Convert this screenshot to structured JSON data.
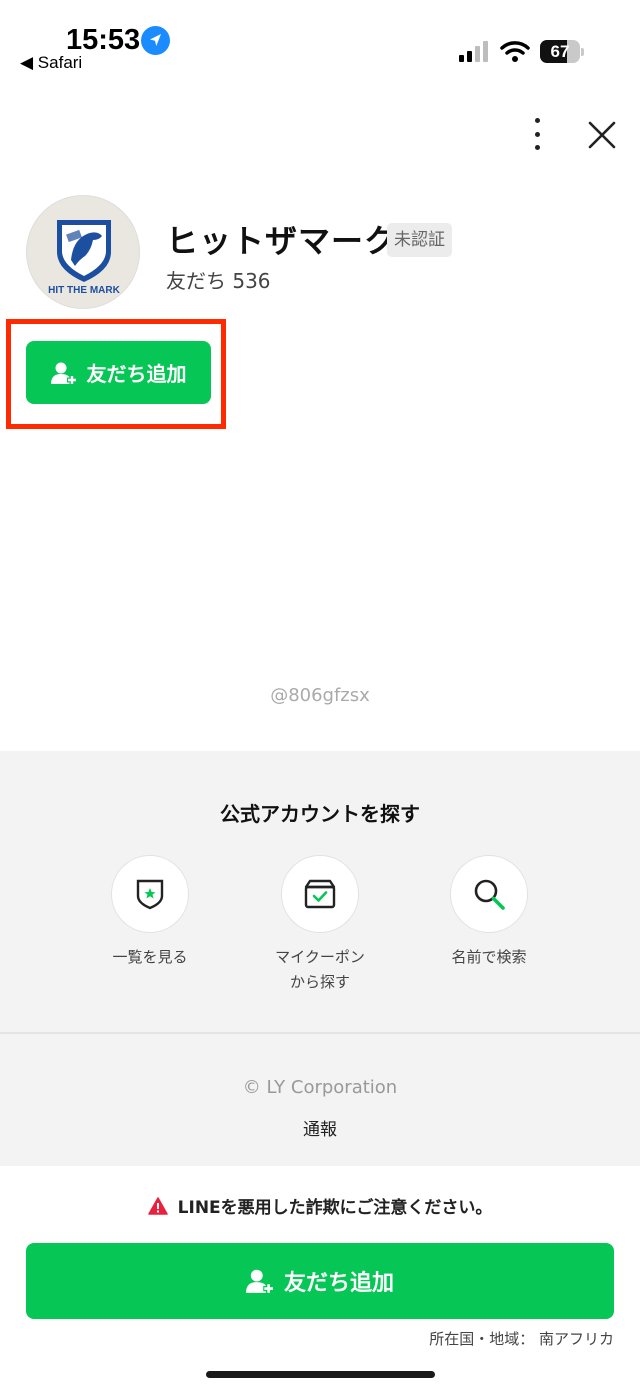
{
  "status_bar": {
    "time": "15:53",
    "back_app": "◀ Safari",
    "battery": "67",
    "battery_fraction": 0.67
  },
  "profile": {
    "name": "ヒットザマーク",
    "badge": "未認証",
    "friends": "友だち 536",
    "logo_text": "HIT THE MARK",
    "add_friend_label": "友だち追加",
    "account_id": "@806gfzsx"
  },
  "find_section": {
    "title": "公式アカウントを探す",
    "items": [
      {
        "label": "一覧を見る",
        "icon": "shield-star-icon"
      },
      {
        "label": "マイクーポン\nから探す",
        "icon": "coupon-box-icon"
      },
      {
        "label": "名前で検索",
        "icon": "search-icon"
      }
    ],
    "copyright": "© LY Corporation",
    "report": "通報"
  },
  "footer": {
    "warning": "LINEを悪用した詐欺にご注意ください。",
    "add_friend_label": "友だち追加",
    "region": "所在国・地域： 南アフリカ"
  },
  "colors": {
    "line_green": "#06c755",
    "highlight_red": "#ff2a00",
    "location_blue": "#1a8cff"
  }
}
